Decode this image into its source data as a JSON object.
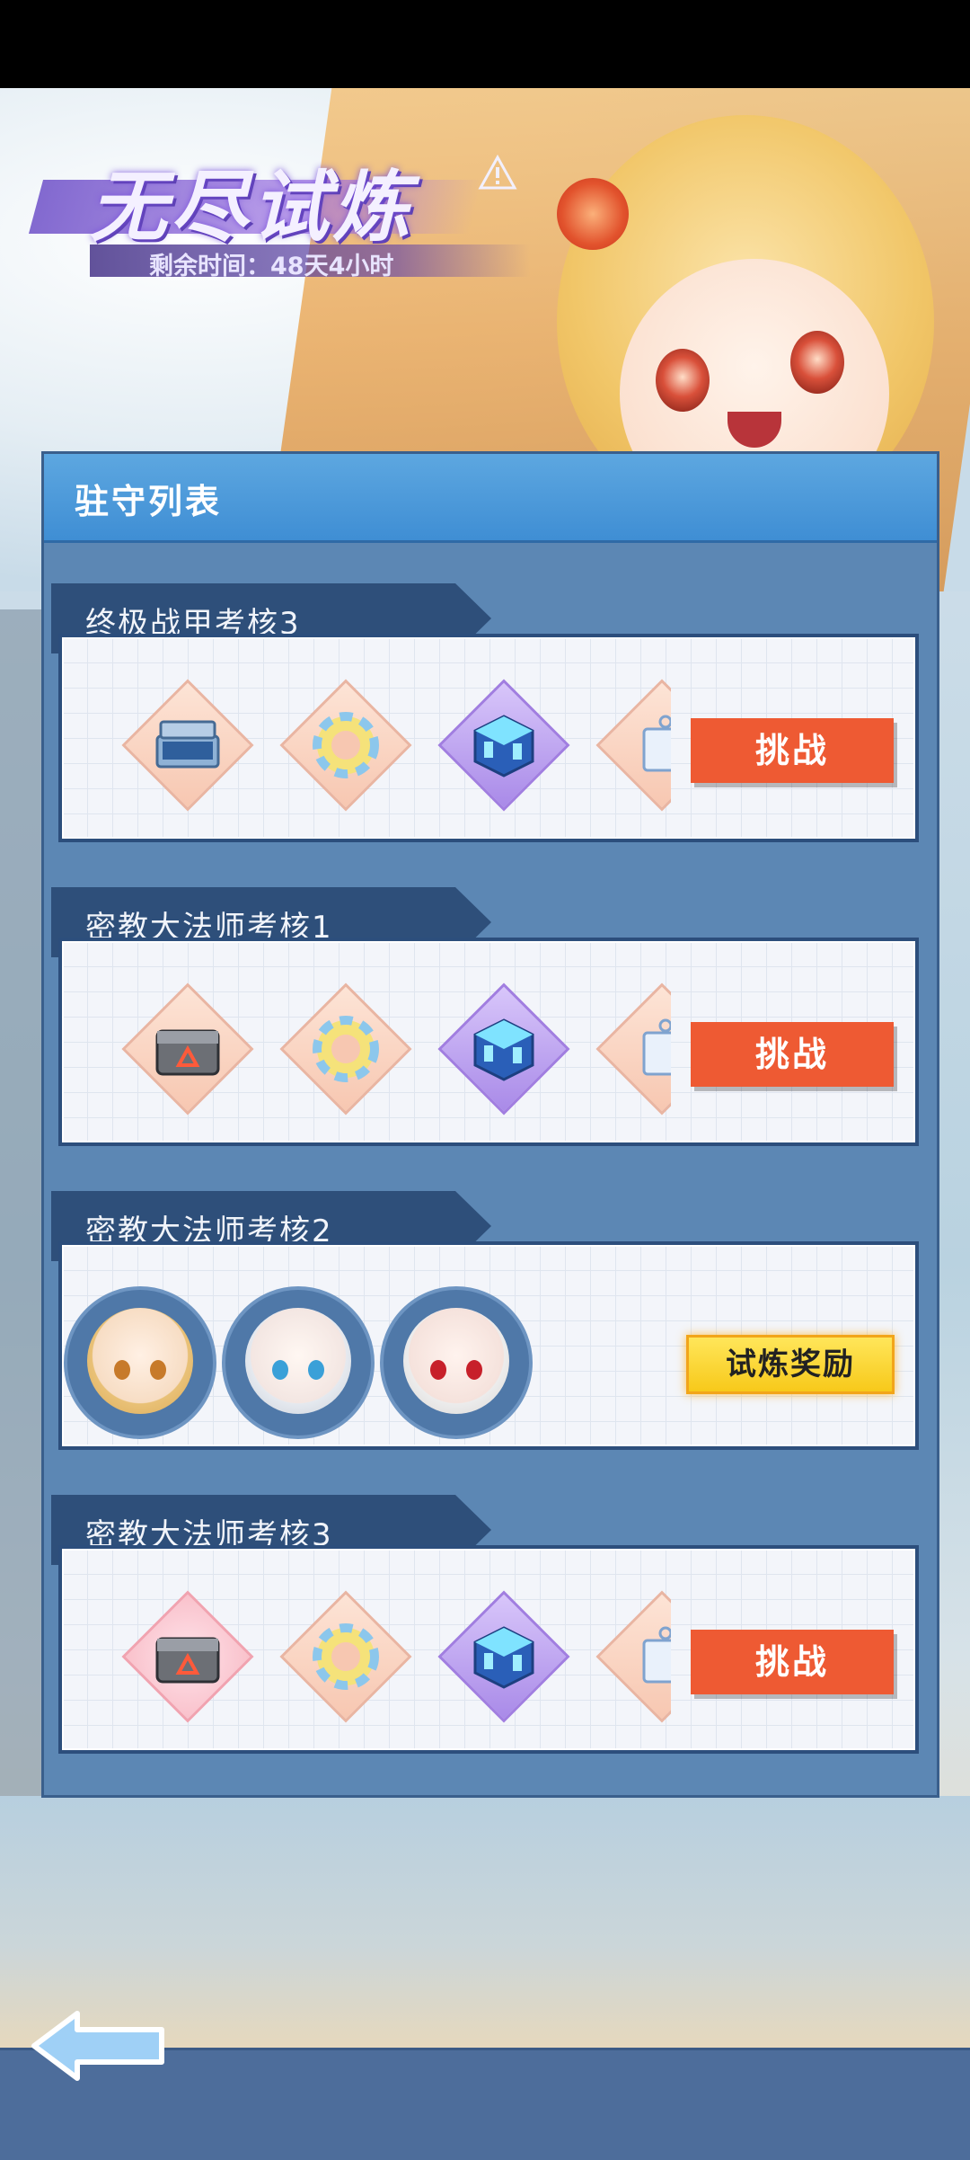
{
  "header": {
    "title": "无尽试炼",
    "timer_label": "剩余时间：48天4小时"
  },
  "panel": {
    "title": "驻守列表"
  },
  "groups": [
    {
      "name": "终极战甲考核3",
      "action_label": "挑战",
      "rewards": [
        "equipment-case-icon",
        "swim-ring-icon",
        "blue-cube-icon",
        "tag-icon"
      ]
    },
    {
      "name": "密教大法师考核1",
      "action_label": "挑战",
      "rewards": [
        "metal-box-icon",
        "swim-ring-icon",
        "blue-cube-icon",
        "tag-icon"
      ]
    },
    {
      "name": "密教大法师考核2",
      "action_label": "试炼奖励",
      "characters": [
        "character-avatar-blonde",
        "character-avatar-silver",
        "character-avatar-white-red-eyes"
      ]
    },
    {
      "name": "密教大法师考核3",
      "action_label": "挑战",
      "rewards": [
        "metal-box-icon",
        "swim-ring-icon",
        "blue-cube-icon",
        "tag-icon"
      ]
    }
  ],
  "colors": {
    "challenge_button": "#ee5a33",
    "reward_button": "#f7c91a",
    "panel": "#5c87b4",
    "panel_header": "#3f8ed4",
    "tab": "#2e4f7a"
  },
  "icons": {
    "back": "back-arrow-icon",
    "warning": "warning-triangle-icon"
  }
}
